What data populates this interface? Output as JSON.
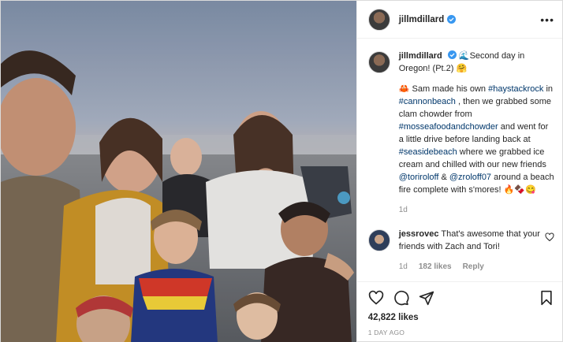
{
  "post": {
    "username": "jillmdillard",
    "verified": true,
    "more_label": "•••"
  },
  "caption": {
    "username": "jillmdillard",
    "line1_emoji": "🌊",
    "line1": "Second day in Oregon! (Pt.2)",
    "line1_end_emoji": "🤗",
    "p1": "🦀 Sam made his own ",
    "tag1": "#haystackrock",
    "p2": " in ",
    "tag2": "#cannonbeach",
    "p3": " , then we grabbed some clam chowder from ",
    "tag3": "#mosseafoodandchowder",
    "p4": " and went for a little drive before landing back at ",
    "tag4": "#seasidebeach",
    "p5": " where we grabbed ice cream and chilled with our new friends ",
    "tag5": "@toriroloff",
    "p6": " & ",
    "tag6": "@zroloff07",
    "p7": " around a beach fire complete with s'mores! 🔥🍫😋",
    "age": "1d"
  },
  "comment": {
    "username": "jessrovec",
    "text": "That's awesome that your friends with Zach and Tori!",
    "age": "1d",
    "likes": "182 likes",
    "reply": "Reply"
  },
  "actions": {
    "like_icon": "heart-icon",
    "comment_icon": "comment-icon",
    "share_icon": "share-icon",
    "save_icon": "bookmark-icon"
  },
  "stats": {
    "likes": "42,822 likes",
    "date": "1 DAY AGO"
  },
  "colors": {
    "link": "#00376b",
    "muted": "#8e8e8e",
    "verified": "#3897f0"
  }
}
